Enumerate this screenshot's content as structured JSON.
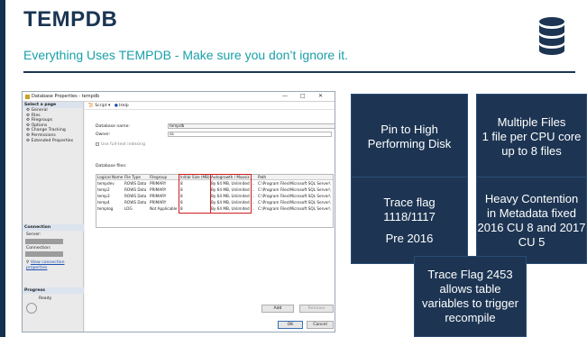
{
  "slide": {
    "title": "TEMPDB",
    "subtitle": "Everything Uses TEMPDB - Make sure you don’t ignore it.",
    "colors": {
      "navy": "#1d3553",
      "teal": "#1aa0a8",
      "highlight_red": "#d21d1d"
    },
    "icon": "database-icon"
  },
  "dialog": {
    "title": "Database Properties - tempdb",
    "controls": [
      "—",
      "□",
      "✕"
    ],
    "toolbar": {
      "script": "Script",
      "help": "Help"
    },
    "select_page_header": "Select a page",
    "pages": [
      "General",
      "Files",
      "Filegroups",
      "Options",
      "Change Tracking",
      "Permissions",
      "Extended Properties"
    ],
    "connection_header": "Connection",
    "server_label": "Server:",
    "connection_label": "Connection:",
    "view_connection_link": "View connection properties",
    "progress_header": "Progress",
    "progress_status": "Ready",
    "database_name_label": "Database name:",
    "database_name_value": "tempdb",
    "owner_label": "Owner:",
    "owner_value": "sa",
    "owner_browse": "...",
    "fulltext_label": "Use full-text indexing",
    "database_files_label": "Database files:",
    "columns": [
      "Logical Name",
      "File Type",
      "Filegroup",
      "Initial Size (MB)",
      "Autogrowth / Maxsize",
      "",
      "Path"
    ],
    "files": [
      {
        "logical_name": "tempdev",
        "file_type": "ROWS Data",
        "filegroup": "PRIMARY",
        "initial_size": "8",
        "autogrowth": "By 64 MB, Unlimited",
        "browse": "...",
        "path": "C:\\Program Files\\Microsoft SQL Server\\"
      },
      {
        "logical_name": "temp2",
        "file_type": "ROWS Data",
        "filegroup": "PRIMARY",
        "initial_size": "8",
        "autogrowth": "By 64 MB, Unlimited",
        "browse": "...",
        "path": "C:\\Program Files\\Microsoft SQL Server\\"
      },
      {
        "logical_name": "temp3",
        "file_type": "ROWS Data",
        "filegroup": "PRIMARY",
        "initial_size": "8",
        "autogrowth": "By 64 MB, Unlimited",
        "browse": "...",
        "path": "C:\\Program Files\\Microsoft SQL Server\\"
      },
      {
        "logical_name": "temp4",
        "file_type": "ROWS Data",
        "filegroup": "PRIMARY",
        "initial_size": "8",
        "autogrowth": "By 64 MB, Unlimited",
        "browse": "...",
        "path": "C:\\Program Files\\Microsoft SQL Server\\"
      },
      {
        "logical_name": "templog",
        "file_type": "LOG",
        "filegroup": "Not Applicable",
        "initial_size": "8",
        "autogrowth": "By 64 MB, Unlimited",
        "browse": "...",
        "path": "C:\\Program Files\\Microsoft SQL Server\\"
      }
    ],
    "add_button": "Add",
    "remove_button": "Remove",
    "ok_button": "OK",
    "cancel_button": "Cancel"
  },
  "boxes": {
    "pin": [
      "Pin to High",
      "Performing Disk"
    ],
    "multiple_files": [
      "Multiple Files",
      "1 file per CPU core",
      "up to 8 files"
    ],
    "trace_flag": [
      "Trace flag",
      "1118/1117",
      "",
      "Pre 2016"
    ],
    "heavy_contention": [
      "Heavy Contention",
      "in Metadata fixed",
      "2016 CU 8 and 2017",
      "CU 5"
    ],
    "trace_2453": [
      "Trace Flag 2453",
      "allows table",
      "variables to trigger",
      "recompile"
    ]
  }
}
